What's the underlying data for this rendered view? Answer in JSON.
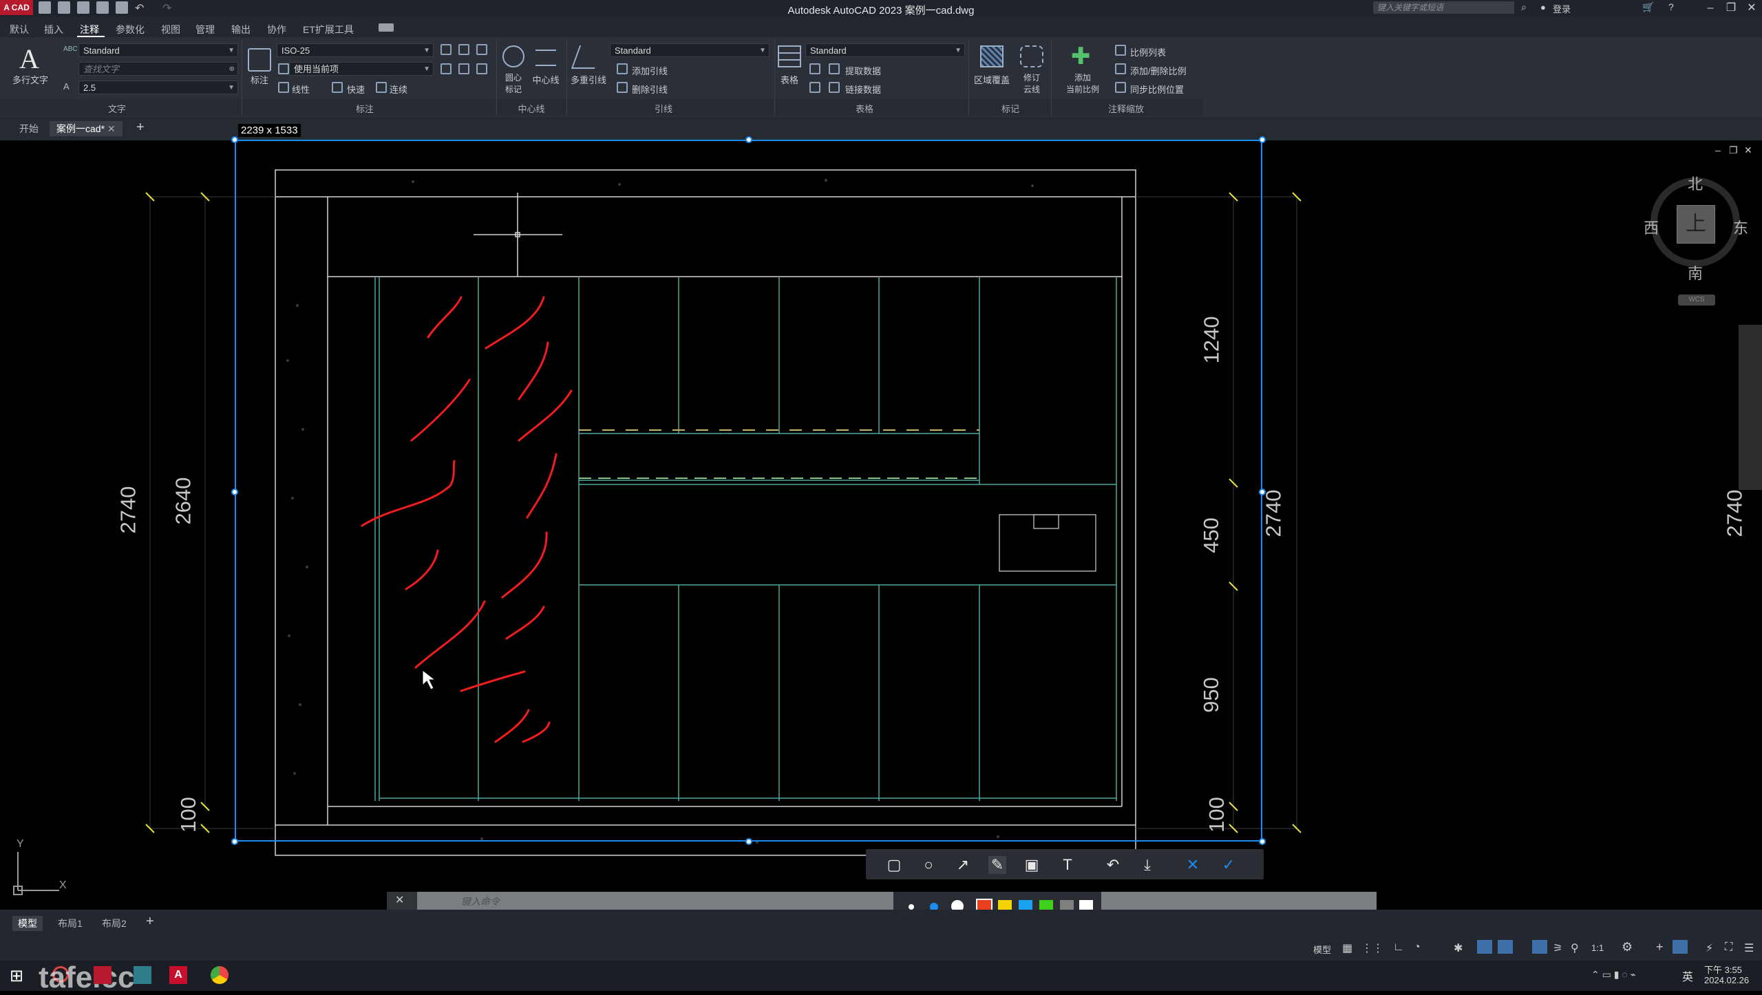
{
  "app": {
    "title": "Autodesk AutoCAD 2023    案例一cad.dwg",
    "logo": "A CAD",
    "search_placeholder": "键入关键字或短语",
    "login": "登录"
  },
  "menu": [
    "默认",
    "插入",
    "注释",
    "参数化",
    "视图",
    "管理",
    "输出",
    "协作",
    "ET扩展工具"
  ],
  "menu_active": "注释",
  "ribbon": {
    "text_panel": {
      "big_button": "多行文字",
      "style_combo": "Standard",
      "find_placeholder": "查找文字",
      "height_combo": "2.5",
      "label": "文字"
    },
    "dim_panel": {
      "big_button": "标注",
      "style_combo": "ISO-25",
      "layer_combo": "使用当前项",
      "linear": "线性",
      "quick": "快速",
      "continue": "连续",
      "label": "标注"
    },
    "centerline_panel": {
      "center_mark": "圆心\n标记",
      "centerline": "中心线",
      "label": "中心线"
    },
    "leader_panel": {
      "big_button": "多重引线",
      "style_combo": "Standard",
      "add": "添加引线",
      "remove": "删除引线",
      "label": "引线"
    },
    "table_panel": {
      "big_button": "表格",
      "style_combo": "Standard",
      "extract": "提取数据",
      "link": "链接数据",
      "label": "表格"
    },
    "markup_panel": {
      "wipeout": "区域覆盖",
      "revcloud": "修订\n云线",
      "label": "标记"
    },
    "annoscale_panel": {
      "add_current": "添加\n当前比例",
      "scale_list": "比例列表",
      "add_delete": "添加/删除比例",
      "sync": "同步比例位置",
      "label": "注释缩放"
    }
  },
  "doc_tabs": [
    "开始",
    "案例一cad*"
  ],
  "capture": {
    "size_readout": "2239 x 1533",
    "tools": [
      "rectangle-icon",
      "ellipse-icon",
      "arrow-icon",
      "pencil-icon",
      "mosaic-icon",
      "text-icon",
      "undo-icon",
      "download-icon",
      "cancel-icon",
      "confirm-icon"
    ],
    "colors": [
      "#e8401c",
      "#f5d300",
      "#1aa3f0",
      "#3fd01c",
      "#808080",
      "#ffffff"
    ]
  },
  "dimensions": {
    "left_outer": "2740",
    "left_inner": "2640",
    "left_bottom": "100",
    "right_1": "1240",
    "right_2": "450",
    "right_3": "950",
    "right_4": "100",
    "right_total": "2740",
    "far_right": "2740"
  },
  "viewcube": {
    "north": "北",
    "south": "南",
    "east": "东",
    "west": "西",
    "top": "上",
    "wcs": "WCS"
  },
  "command": {
    "placeholder": "键入命令"
  },
  "layout_tabs": [
    "模型",
    "布局1",
    "布局2"
  ],
  "status": {
    "model": "模型",
    "scale": "1:1"
  },
  "taskbar": {
    "watermark": "tafe.cc",
    "ime": "英",
    "time": "下午 3:55",
    "date": "2024.02.26"
  },
  "ucs": {
    "x": "X",
    "y": "Y"
  }
}
